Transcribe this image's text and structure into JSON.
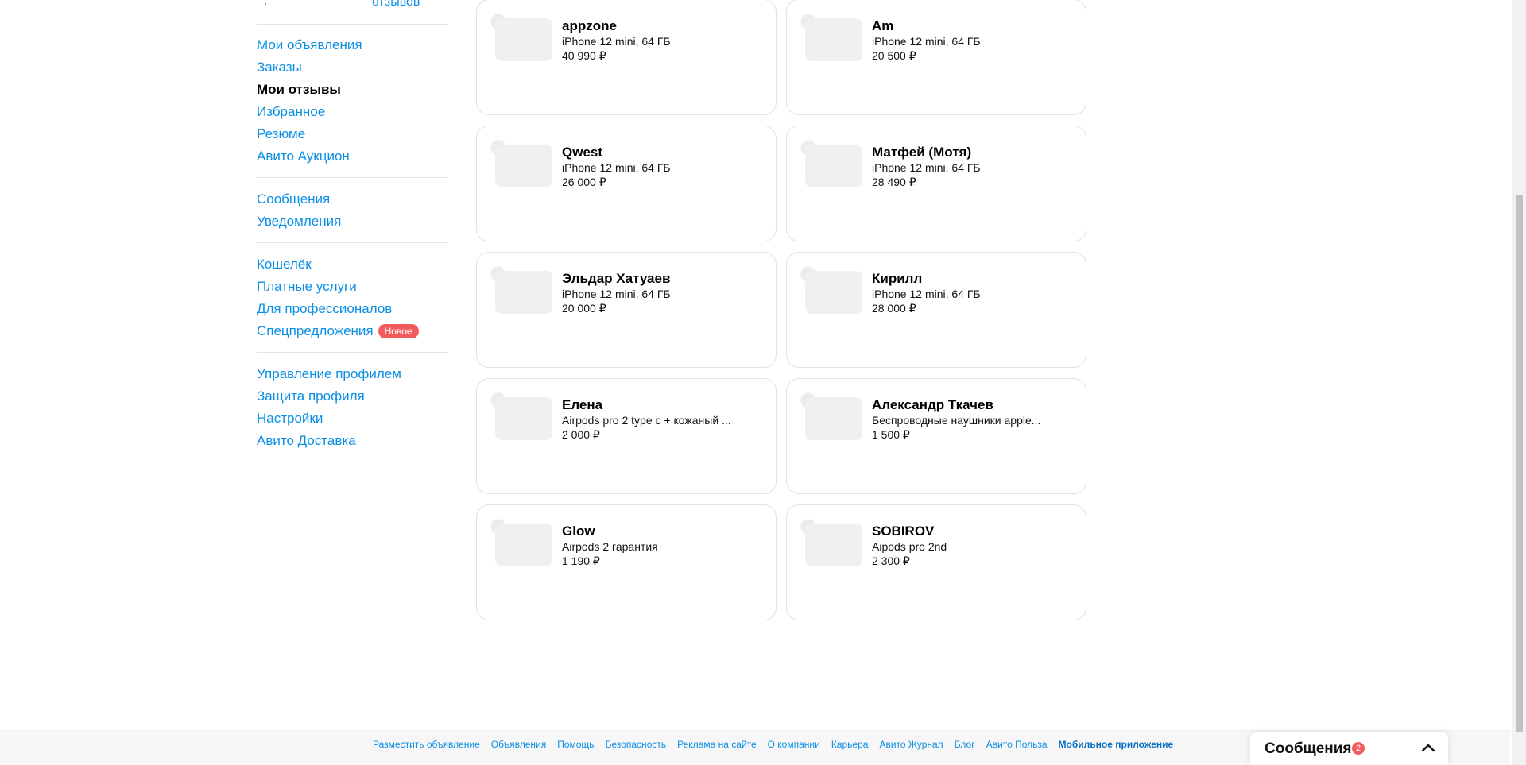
{
  "sidebar": {
    "reviews_link": "отзывов",
    "groups": [
      [
        {
          "label": "Мои объявления",
          "active": false
        },
        {
          "label": "Заказы",
          "active": false
        },
        {
          "label": "Мои отзывы",
          "active": true
        },
        {
          "label": "Избранное",
          "active": false
        },
        {
          "label": "Резюме",
          "active": false
        },
        {
          "label": "Авито Аукцион",
          "active": false
        }
      ],
      [
        {
          "label": "Сообщения",
          "active": false
        },
        {
          "label": "Уведомления",
          "active": false
        }
      ],
      [
        {
          "label": "Кошелёк",
          "active": false
        },
        {
          "label": "Платные услуги",
          "active": false
        },
        {
          "label": "Для профессионалов",
          "active": false
        },
        {
          "label": "Спецпредложения",
          "active": false,
          "badge": "Новое"
        }
      ],
      [
        {
          "label": "Управление профилем",
          "active": false
        },
        {
          "label": "Защита профиля",
          "active": false
        },
        {
          "label": "Настройки",
          "active": false
        },
        {
          "label": "Авито Доставка",
          "active": false
        }
      ]
    ]
  },
  "reviews": [
    {
      "author": "appzone",
      "title": "iPhone 12 mini, 64 ГБ",
      "price": "40 990 ₽"
    },
    {
      "author": "Am",
      "title": "iPhone 12 mini, 64 ГБ",
      "price": "20 500 ₽"
    },
    {
      "author": "Qwest",
      "title": "iPhone 12 mini, 64 ГБ",
      "price": "26 000 ₽"
    },
    {
      "author": "Матфей (Мотя)",
      "title": "iPhone 12 mini, 64 ГБ",
      "price": "28 490 ₽"
    },
    {
      "author": "Эльдар Хатуаев",
      "title": "iPhone 12 mini, 64 ГБ",
      "price": "20 000 ₽"
    },
    {
      "author": "Кирилл",
      "title": "iPhone 12 mini, 64 ГБ",
      "price": "28 000 ₽"
    },
    {
      "author": "Елена",
      "title": "Airpods pro 2 type c + кожаный ...",
      "price": "2 000 ₽"
    },
    {
      "author": "Александр Ткачев",
      "title": "Беспроводные наушники apple...",
      "price": "1 500 ₽"
    },
    {
      "author": "Glow",
      "title": "Airpods 2 гарантия",
      "price": "1 190 ₽"
    },
    {
      "author": "SOBIROV",
      "title": "Aipods pro 2nd",
      "price": "2 300 ₽"
    }
  ],
  "footer": {
    "links": [
      {
        "label": "Разместить объявление",
        "bold": false
      },
      {
        "label": "Объявления",
        "bold": false
      },
      {
        "label": "Помощь",
        "bold": false
      },
      {
        "label": "Безопасность",
        "bold": false
      },
      {
        "label": "Реклама на сайте",
        "bold": false
      },
      {
        "label": "О компании",
        "bold": false
      },
      {
        "label": "Карьера",
        "bold": false
      },
      {
        "label": "Авито Журнал",
        "bold": false
      },
      {
        "label": "Блог",
        "bold": false
      },
      {
        "label": "Авито Польза",
        "bold": false
      },
      {
        "label": "Мобильное приложение",
        "bold": true
      }
    ]
  },
  "messages_panel": {
    "label": "Сообщения",
    "count": "2",
    "expand_icon": "chevron-up-icon"
  },
  "colors": {
    "link": "#0a8fe6",
    "badge": "#f25b5b",
    "card_border": "#e2e2e2"
  }
}
